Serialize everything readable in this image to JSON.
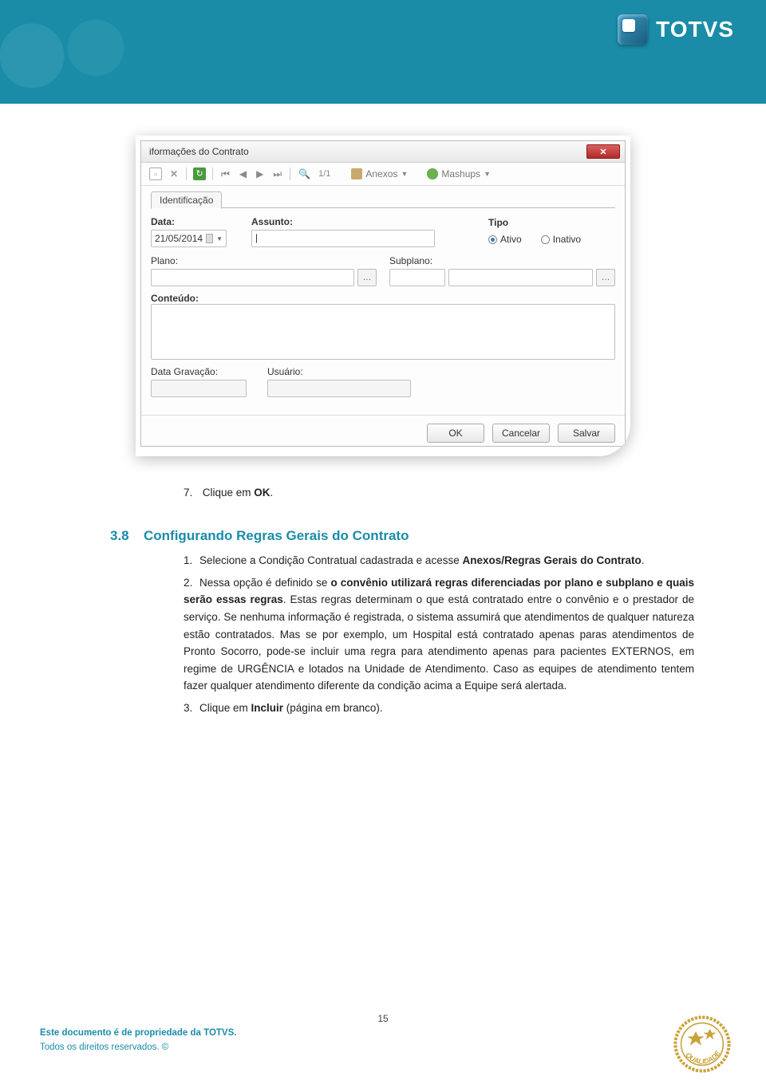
{
  "logo_text": "TOTVS",
  "dialog": {
    "title": "iformações do Contrato",
    "toolbar": {
      "page": "1/1",
      "anexos": "Anexos",
      "mashups": "Mashups"
    },
    "tab": "Identificação",
    "labels": {
      "data": "Data:",
      "assunto": "Assunto:",
      "tipo": "Tipo",
      "ativo": "Ativo",
      "inativo": "Inativo",
      "plano": "Plano:",
      "subplano": "Subplano:",
      "conteudo": "Conteúdo:",
      "data_gravacao": "Data Gravação:",
      "usuario": "Usuário:"
    },
    "values": {
      "data": "21/05/2014"
    },
    "buttons": {
      "ok": "OK",
      "cancelar": "Cancelar",
      "salvar": "Salvar"
    }
  },
  "step7_num": "7.",
  "step7_text_a": "Clique em ",
  "step7_text_b": "OK",
  "step7_text_c": ".",
  "section": {
    "num": "3.8",
    "title": "Configurando Regras Gerais do Contrato"
  },
  "list": {
    "i1_num": "1.",
    "i1_a": "Selecione a Condição Contratual cadastrada e acesse ",
    "i1_b": "Anexos/Regras Gerais do Contrato",
    "i1_c": ".",
    "i2_num": "2.",
    "i2_a": "Nessa opção é definido se ",
    "i2_b": "o convênio utilizará regras diferenciadas por plano e subplano e quais serão essas regras",
    "i2_c": ". Estas regras determinam o que está contratado entre o convênio e o prestador de serviço. Se nenhuma informação é registrada, o sistema assumirá que atendimentos de qualquer natureza estão contratados. Mas se por exemplo, um Hospital está contratado apenas paras atendimentos de Pronto Socorro, pode-se incluir uma regra para atendimento apenas para pacientes EXTERNOS, em regime de URGÊNCIA e lotados na Unidade de Atendimento. Caso as equipes de atendimento tentem fazer qualquer atendimento diferente da condição acima a Equipe será alertada.",
    "i3_num": "3.",
    "i3_a": "Clique em ",
    "i3_b": "Incluir",
    "i3_c": " (página em branco)."
  },
  "footer": {
    "line1": "Este documento é de propriedade da TOTVS.",
    "line2": "Todos os direitos reservados. ©",
    "page": "15",
    "stamp": "QUALIDADE DOC"
  }
}
